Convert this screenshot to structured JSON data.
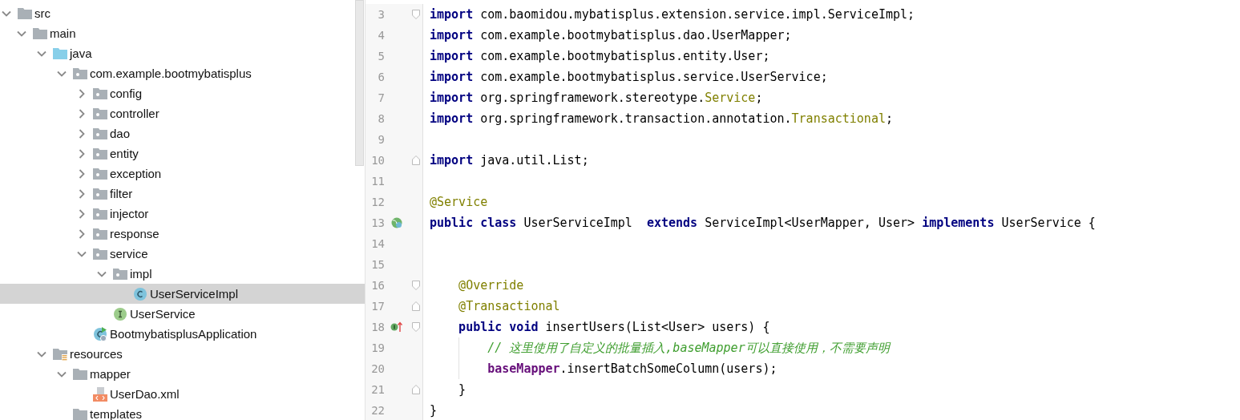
{
  "project_tree": [
    {
      "label": "src",
      "kind": "folder",
      "expanded": true,
      "selected": false,
      "children": [
        {
          "label": "main",
          "kind": "folder",
          "expanded": true,
          "selected": false,
          "children": [
            {
              "label": "java",
              "kind": "source-folder",
              "expanded": true,
              "selected": false,
              "children": [
                {
                  "label": "com.example.bootmybatisplus",
                  "kind": "package",
                  "expanded": true,
                  "selected": false,
                  "children": [
                    {
                      "label": "config",
                      "kind": "package",
                      "expanded": false,
                      "selected": false
                    },
                    {
                      "label": "controller",
                      "kind": "package",
                      "expanded": false,
                      "selected": false
                    },
                    {
                      "label": "dao",
                      "kind": "package",
                      "expanded": false,
                      "selected": false
                    },
                    {
                      "label": "entity",
                      "kind": "package",
                      "expanded": false,
                      "selected": false
                    },
                    {
                      "label": "exception",
                      "kind": "package",
                      "expanded": false,
                      "selected": false
                    },
                    {
                      "label": "filter",
                      "kind": "package",
                      "expanded": false,
                      "selected": false
                    },
                    {
                      "label": "injector",
                      "kind": "package",
                      "expanded": false,
                      "selected": false
                    },
                    {
                      "label": "response",
                      "kind": "package",
                      "expanded": false,
                      "selected": false
                    },
                    {
                      "label": "service",
                      "kind": "package",
                      "expanded": true,
                      "selected": false,
                      "children": [
                        {
                          "label": "impl",
                          "kind": "package",
                          "expanded": true,
                          "selected": false,
                          "children": [
                            {
                              "label": "UserServiceImpl",
                              "kind": "class",
                              "selected": true
                            }
                          ]
                        },
                        {
                          "label": "UserService",
                          "kind": "interface",
                          "selected": false
                        }
                      ]
                    },
                    {
                      "label": "BootmybatisplusApplication",
                      "kind": "app-class",
                      "selected": false
                    }
                  ]
                }
              ]
            },
            {
              "label": "resources",
              "kind": "resource-folder",
              "expanded": true,
              "selected": false,
              "children": [
                {
                  "label": "mapper",
                  "kind": "folder",
                  "expanded": true,
                  "selected": false,
                  "children": [
                    {
                      "label": "UserDao.xml",
                      "kind": "xml-file",
                      "selected": false
                    }
                  ]
                },
                {
                  "label": "templates",
                  "kind": "folder",
                  "selected": false
                }
              ]
            }
          ]
        }
      ]
    }
  ],
  "editor": {
    "lines": [
      {
        "number": "3",
        "markers": [
          {
            "kind": "fold-start"
          }
        ],
        "tokens": [
          {
            "kind": "keyword",
            "text": "import"
          },
          {
            "kind": "plain",
            "text": " com.baomidou.mybatisplus.extension.service.impl.ServiceImpl;"
          }
        ]
      },
      {
        "number": "4",
        "tokens": [
          {
            "kind": "keyword",
            "text": "import"
          },
          {
            "kind": "plain",
            "text": " com.example.bootmybatisplus.dao.UserMapper;"
          }
        ]
      },
      {
        "number": "5",
        "tokens": [
          {
            "kind": "keyword",
            "text": "import"
          },
          {
            "kind": "plain",
            "text": " com.example.bootmybatisplus.entity.User;"
          }
        ]
      },
      {
        "number": "6",
        "tokens": [
          {
            "kind": "keyword",
            "text": "import"
          },
          {
            "kind": "plain",
            "text": " com.example.bootmybatisplus.service.UserService;"
          }
        ]
      },
      {
        "number": "7",
        "tokens": [
          {
            "kind": "keyword",
            "text": "import"
          },
          {
            "kind": "plain",
            "text": " org.springframework.stereotype."
          },
          {
            "kind": "annotation",
            "text": "Service"
          },
          {
            "kind": "plain",
            "text": ";"
          }
        ]
      },
      {
        "number": "8",
        "tokens": [
          {
            "kind": "keyword",
            "text": "import"
          },
          {
            "kind": "plain",
            "text": " org.springframework.transaction.annotation."
          },
          {
            "kind": "annotation",
            "text": "Transactional"
          },
          {
            "kind": "plain",
            "text": ";"
          }
        ]
      },
      {
        "number": "9"
      },
      {
        "number": "10",
        "markers": [
          {
            "kind": "fold-end"
          }
        ],
        "tokens": [
          {
            "kind": "keyword",
            "text": "import"
          },
          {
            "kind": "plain",
            "text": " java.util.List;"
          }
        ]
      },
      {
        "number": "11"
      },
      {
        "number": "12",
        "tokens": [
          {
            "kind": "annotation",
            "text": "@Service"
          }
        ]
      },
      {
        "number": "13",
        "markers": [
          {
            "kind": "bean"
          }
        ],
        "tokens": [
          {
            "kind": "keyword",
            "text": "public class"
          },
          {
            "kind": "plain",
            "text": " UserServiceImpl  "
          },
          {
            "kind": "keyword",
            "text": "extends"
          },
          {
            "kind": "plain",
            "text": " ServiceImpl<UserMapper, User> "
          },
          {
            "kind": "keyword",
            "text": "implements"
          },
          {
            "kind": "plain",
            "text": " UserService {"
          }
        ]
      },
      {
        "number": "14"
      },
      {
        "number": "15"
      },
      {
        "number": "16",
        "markers": [
          {
            "kind": "fold-start"
          }
        ],
        "tokens": [
          {
            "kind": "annotation",
            "text": "    @Override"
          }
        ]
      },
      {
        "number": "17",
        "markers": [
          {
            "kind": "fold-end"
          }
        ],
        "tokens": [
          {
            "kind": "annotation",
            "text": "    @Transactional"
          }
        ]
      },
      {
        "number": "18",
        "markers": [
          {
            "kind": "implements"
          },
          {
            "kind": "fold-start"
          }
        ],
        "tokens": [
          {
            "kind": "keyword",
            "text": "    public void"
          },
          {
            "kind": "plain",
            "text": " insertUsers(List<User> users) {"
          }
        ]
      },
      {
        "number": "19",
        "tokens": [
          {
            "kind": "comment",
            "text": "        // 这里使用了自定义的批量插入,baseMapper可以直接使用，不需要声明"
          }
        ]
      },
      {
        "number": "20",
        "tokens": [
          {
            "kind": "field",
            "text": "        baseMapper"
          },
          {
            "kind": "plain",
            "text": ".insertBatchSomeColumn(users);"
          }
        ]
      },
      {
        "number": "21",
        "markers": [
          {
            "kind": "fold-end"
          }
        ],
        "tokens": [
          {
            "kind": "plain",
            "text": "    }"
          }
        ]
      },
      {
        "number": "22",
        "tokens": [
          {
            "kind": "plain",
            "text": "}"
          }
        ]
      }
    ]
  }
}
